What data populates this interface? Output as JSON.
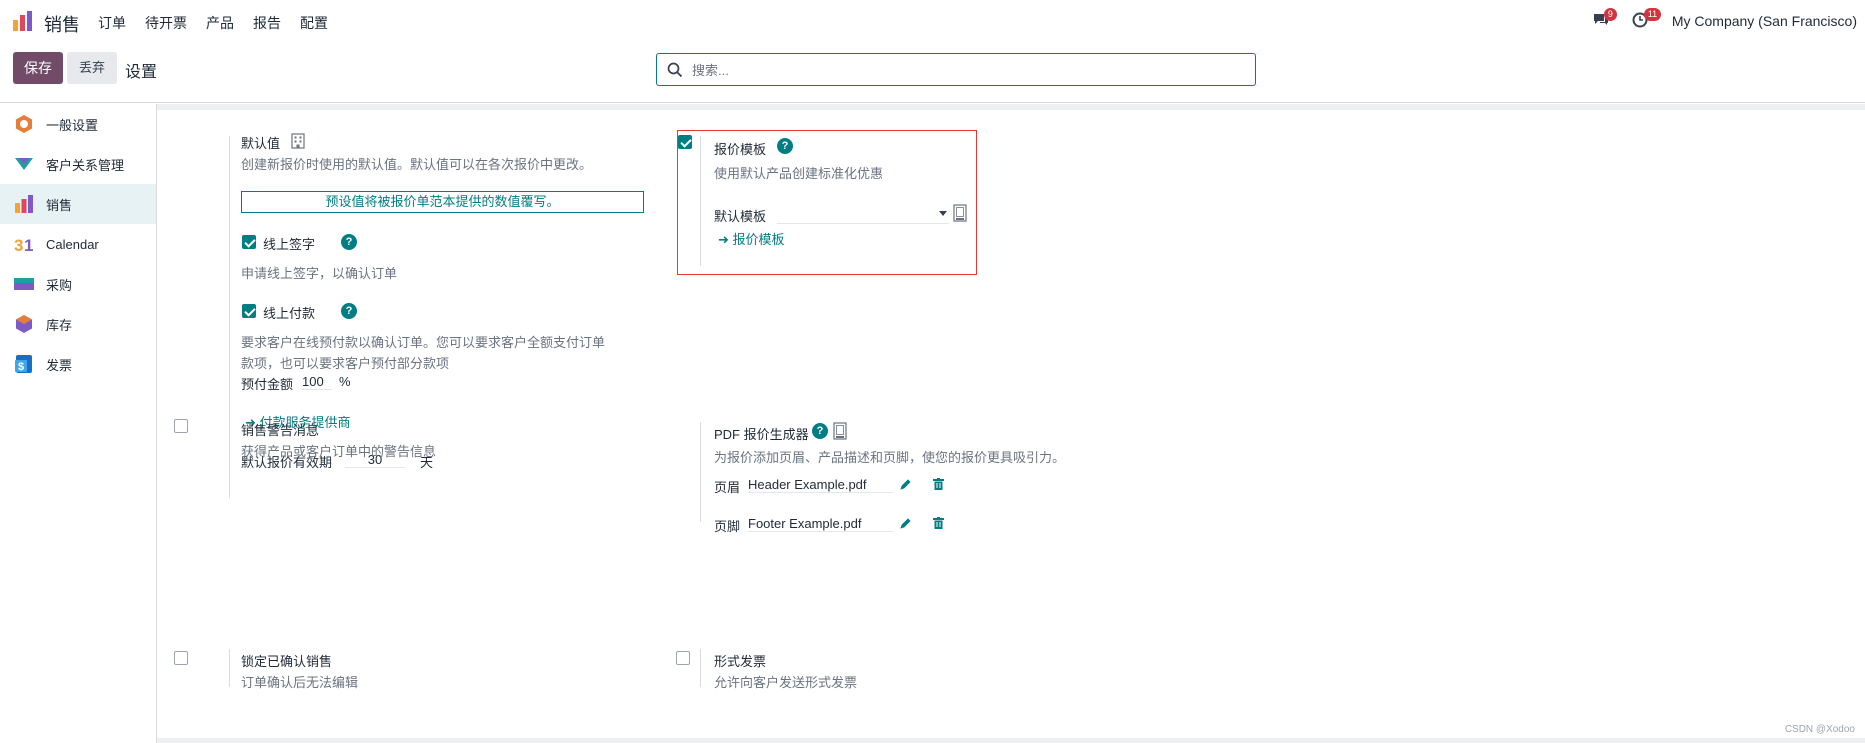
{
  "topnav": {
    "app_name": "销售",
    "menu": [
      "订单",
      "待开票",
      "产品",
      "报告",
      "配置"
    ],
    "messages_badge": "9",
    "activity_badge": "11",
    "company": "My Company (San Francisco)"
  },
  "controlbar": {
    "save_label": "保存",
    "discard_label": "丢弃",
    "breadcrumb": "设置",
    "search_placeholder": "搜索..."
  },
  "sidebar": {
    "items": [
      {
        "label": "一般设置",
        "icon": "general-settings-icon"
      },
      {
        "label": "客户关系管理",
        "icon": "crm-icon"
      },
      {
        "label": "销售",
        "icon": "sales-icon",
        "active": true
      },
      {
        "label": "Calendar",
        "icon": "calendar-icon"
      },
      {
        "label": "采购",
        "icon": "purchase-icon"
      },
      {
        "label": "库存",
        "icon": "inventory-icon"
      },
      {
        "label": "发票",
        "icon": "invoice-icon"
      }
    ]
  },
  "settings": {
    "defaults": {
      "title": "默认值",
      "desc": "创建新报价时使用的默认值。默认值可以在各次报价中更改。",
      "alert": "预设值将被报价单范本提供的数值覆写。"
    },
    "online_signature": {
      "checked": true,
      "title": "线上签字",
      "desc": "申请线上签字，以确认订单"
    },
    "online_payment": {
      "checked": true,
      "title": "线上付款",
      "desc_line1": "要求客户在线预付款以确认订单。您可以要求客户全额支付订单",
      "desc_line2": "款项，也可以要求客户预付部分款项",
      "prepay_label": "预付金额",
      "prepay_value": "100",
      "prepay_unit": "%",
      "provider_link": "付款服务提供商"
    },
    "validity": {
      "label": "默认报价有效期",
      "value": "30",
      "unit": "天"
    },
    "quotation_template": {
      "checked": true,
      "title": "报价模板",
      "desc": "使用默认产品创建标准化优惠",
      "field_label": "默认模板",
      "field_value": "",
      "link": "报价模板"
    },
    "sale_warnings": {
      "checked": false,
      "title": "销售警告消息",
      "desc": "获得产品或客户订单中的警告信息"
    },
    "pdf_builder": {
      "title": "PDF 报价生成器",
      "desc": "为报价添加页眉、产品描述和页脚，使您的报价更具吸引力。",
      "header_label": "页眉",
      "header_file": "Header Example.pdf",
      "footer_label": "页脚",
      "footer_file": "Footer Example.pdf"
    },
    "lock_confirmed": {
      "checked": false,
      "title": "锁定已确认销售",
      "desc": "订单确认后无法编辑"
    },
    "proforma": {
      "checked": false,
      "title": "形式发票",
      "desc": "允许向客户发送形式发票"
    }
  },
  "watermark": "CSDN @Xodoo",
  "colors": {
    "brand": "#714b67",
    "accent": "#017e84",
    "highlight": "#e53935"
  }
}
